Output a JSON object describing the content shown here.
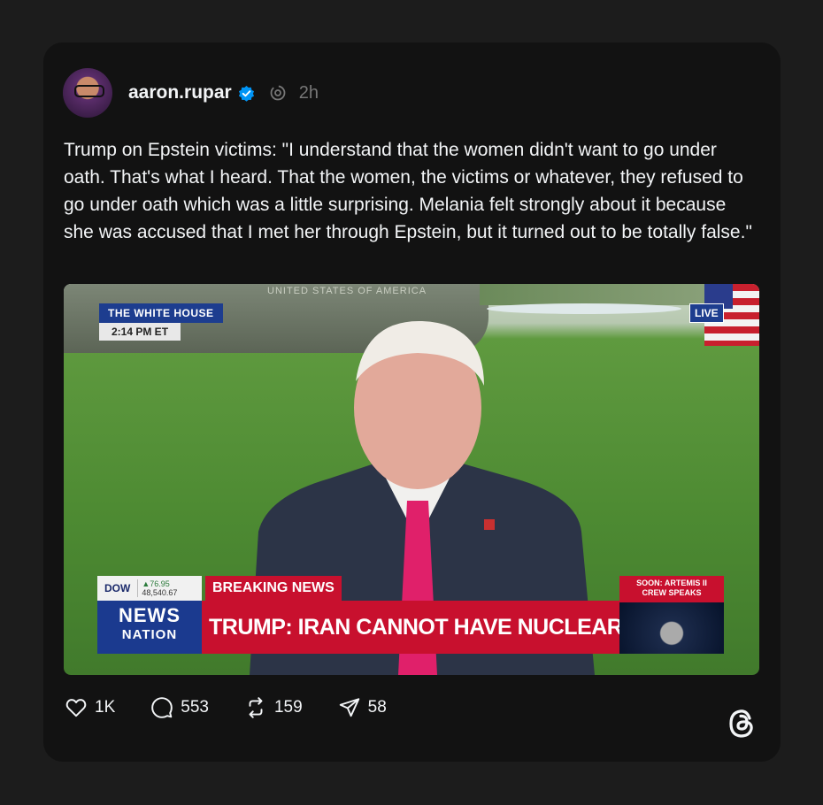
{
  "post": {
    "username": "aaron.rupar",
    "time": "2h",
    "text": "Trump on Epstein victims: \"I understand that the women didn't want to go under oath. That's what I heard. That the women, the victims or whatever, they refused to go under oath which was a little surprising. Melania felt strongly about it because she was accused that I met her through Epstein, but it turned out to be totally false.\""
  },
  "video": {
    "location_chip": "THE WHITE HOUSE",
    "time_chip": "2:14 PM ET",
    "live_label": "LIVE",
    "dow_label": "DOW",
    "dow_change": "▲76.95",
    "dow_value": "48,540.67",
    "breaking_label": "BREAKING NEWS",
    "headline": "TRUMP: IRAN CANNOT HAVE NUCLEAR WEAPON",
    "network_top": "NEWS",
    "network_bottom": "NATION",
    "soon_line1": "SOON: ARTEMIS II",
    "soon_line2": "CREW SPEAKS"
  },
  "actions": {
    "likes": "1K",
    "replies": "553",
    "reposts": "159",
    "shares": "58"
  },
  "icons": [
    "verified-badge-icon",
    "auto-activity-icon",
    "heart-icon",
    "comment-icon",
    "repost-icon",
    "share-icon",
    "threads-logo-icon"
  ],
  "colors": {
    "accent_verified": "#0095f6",
    "breaking_red": "#c8102e",
    "network_blue": "#1b3a8f"
  }
}
